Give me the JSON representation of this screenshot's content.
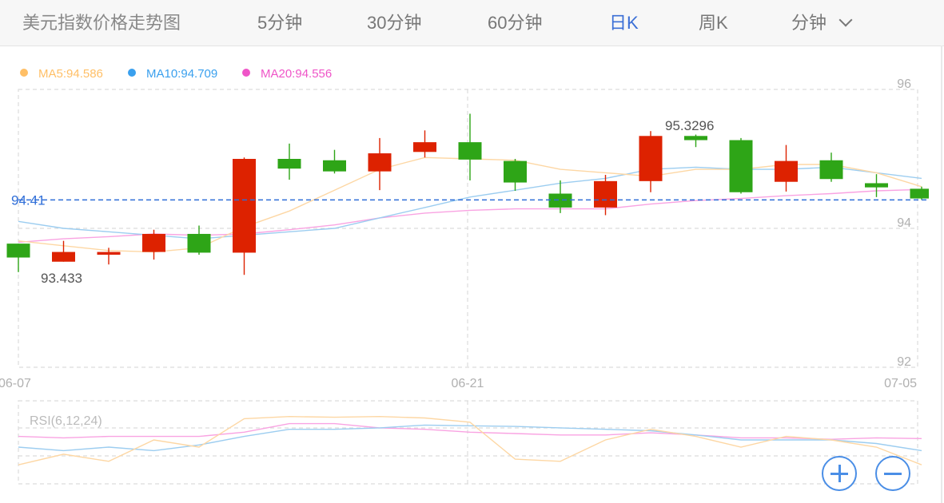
{
  "tabs": {
    "title": "美元指数价格走势图",
    "min5": "5分钟",
    "min30": "30分钟",
    "min60": "60分钟",
    "daily": "日K",
    "weekly": "周K",
    "minute": "分钟"
  },
  "legend": {
    "ma5": "MA5:94.586",
    "ma10": "MA10:94.709",
    "ma20": "MA20:94.556"
  },
  "colors": {
    "up": "#dd2200",
    "down": "#2ea517",
    "ma5": "#ffbf66",
    "ma10": "#3aa0ee",
    "ma20": "#ef55c8",
    "ma5_line": "#fdd7a4",
    "ma10_line": "#9ccdf0",
    "ma20_line": "#f9a3e2",
    "current_price": "#2f6ed8",
    "accent": "#3b6fd6"
  },
  "chart_data": {
    "type": "candlestick",
    "ylim": [
      92,
      96
    ],
    "y_ticks": [
      "96",
      "94",
      "92"
    ],
    "x_tick_labels": [
      "06-07",
      "06-21",
      "07-05"
    ],
    "current_price": "94.41",
    "max_label": "95.3296",
    "min_label": "93.433",
    "candles": [
      {
        "open": 93.78,
        "close": 93.58,
        "high": 93.78,
        "low": 93.37
      },
      {
        "open": 93.52,
        "close": 93.66,
        "high": 93.82,
        "low": 93.52
      },
      {
        "open": 93.62,
        "close": 93.66,
        "high": 93.72,
        "low": 93.48
      },
      {
        "open": 93.66,
        "close": 93.92,
        "high": 93.98,
        "low": 93.55
      },
      {
        "open": 93.92,
        "close": 93.65,
        "high": 94.04,
        "low": 93.62
      },
      {
        "open": 93.65,
        "close": 95.0,
        "high": 95.02,
        "low": 93.33
      },
      {
        "open": 95.0,
        "close": 94.86,
        "high": 95.22,
        "low": 94.7
      },
      {
        "open": 94.98,
        "close": 94.82,
        "high": 95.13,
        "low": 94.79
      },
      {
        "open": 94.82,
        "close": 95.08,
        "high": 95.3,
        "low": 94.55
      },
      {
        "open": 95.1,
        "close": 95.24,
        "high": 95.41,
        "low": 95.02
      },
      {
        "open": 95.24,
        "close": 94.99,
        "high": 95.65,
        "low": 94.69
      },
      {
        "open": 94.97,
        "close": 94.66,
        "high": 95.0,
        "low": 94.54
      },
      {
        "open": 94.5,
        "close": 94.3,
        "high": 94.69,
        "low": 94.22
      },
      {
        "open": 94.3,
        "close": 94.68,
        "high": 94.77,
        "low": 94.19
      },
      {
        "open": 94.68,
        "close": 95.33,
        "high": 95.4,
        "low": 94.52
      },
      {
        "open": 95.33,
        "close": 95.27,
        "high": 95.35,
        "low": 95.17
      },
      {
        "open": 95.27,
        "close": 94.52,
        "high": 95.3,
        "low": 94.5
      },
      {
        "open": 94.67,
        "close": 94.97,
        "high": 95.2,
        "low": 94.53
      },
      {
        "open": 94.98,
        "close": 94.71,
        "high": 95.09,
        "low": 94.67
      },
      {
        "open": 94.65,
        "close": 94.59,
        "high": 94.78,
        "low": 94.45
      },
      {
        "open": 94.57,
        "close": 94.43,
        "high": 94.6,
        "low": 94.41
      }
    ],
    "ma5": [
      93.82,
      93.75,
      93.68,
      93.66,
      93.72,
      94.02,
      94.25,
      94.55,
      94.85,
      95.02,
      95.0,
      94.98,
      94.85,
      94.8,
      94.75,
      94.85,
      94.85,
      94.92,
      94.92,
      94.8,
      94.6
    ],
    "ma10": [
      94.1,
      94.0,
      93.95,
      93.9,
      93.85,
      93.9,
      93.95,
      94.0,
      94.15,
      94.3,
      94.45,
      94.55,
      94.65,
      94.72,
      94.85,
      94.88,
      94.85,
      94.85,
      94.88,
      94.8,
      94.72
    ],
    "ma20": [
      93.8,
      93.85,
      93.88,
      93.92,
      93.9,
      93.92,
      93.98,
      94.05,
      94.15,
      94.22,
      94.26,
      94.28,
      94.28,
      94.28,
      94.35,
      94.4,
      94.43,
      94.47,
      94.5,
      94.54,
      94.56
    ],
    "rsi": {
      "label": "RSI(6,12,24)",
      "rsi6": [
        20,
        35,
        25,
        55,
        45,
        85,
        88,
        87,
        88,
        86,
        80,
        28,
        25,
        55,
        70,
        60,
        45,
        60,
        55,
        45,
        20
      ],
      "rsi12": [
        45,
        40,
        45,
        40,
        48,
        60,
        70,
        70,
        72,
        76,
        75,
        74,
        72,
        70,
        68,
        62,
        55,
        55,
        55,
        50,
        40
      ],
      "rsi24": [
        60,
        58,
        60,
        60,
        60,
        66,
        78,
        78,
        72,
        70,
        66,
        64,
        62,
        62,
        65,
        62,
        58,
        58,
        56,
        58,
        57
      ]
    }
  }
}
